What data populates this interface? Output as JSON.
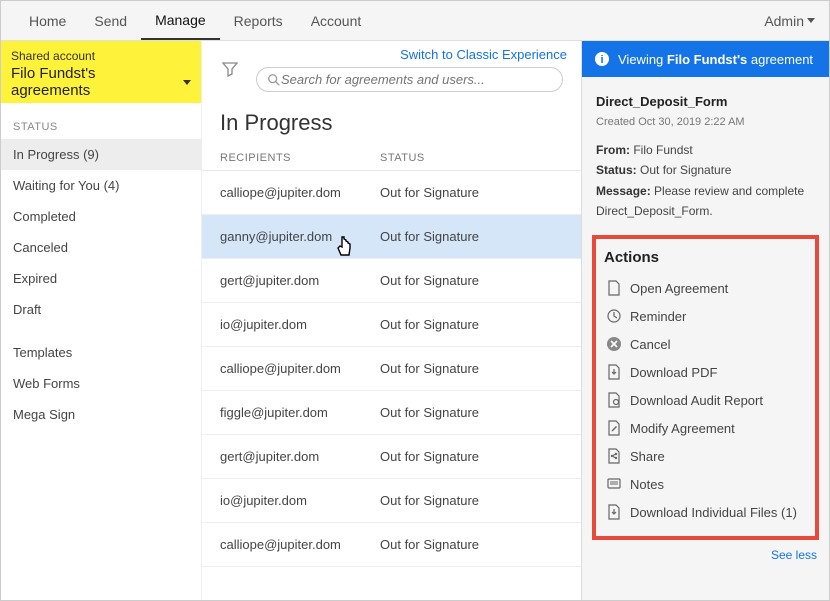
{
  "topnav": {
    "items": [
      "Home",
      "Send",
      "Manage",
      "Reports",
      "Account"
    ],
    "active": "Manage",
    "admin": "Admin"
  },
  "classic_link": "Switch to Classic Experience",
  "shared": {
    "label": "Shared account",
    "who": "Filo Fundst's agreements"
  },
  "search": {
    "placeholder": "Search for agreements and users..."
  },
  "sidebar": {
    "heading": "STATUS",
    "filters": [
      {
        "label": "In Progress (9)",
        "selected": true
      },
      {
        "label": "Waiting for You (4)"
      },
      {
        "label": "Completed"
      },
      {
        "label": "Canceled"
      },
      {
        "label": "Expired"
      },
      {
        "label": "Draft"
      }
    ],
    "other": [
      "Templates",
      "Web Forms",
      "Mega Sign"
    ]
  },
  "main": {
    "title": "In Progress",
    "cols": {
      "recipients": "RECIPIENTS",
      "status": "STATUS"
    },
    "rows": [
      {
        "recipient": "calliope@jupiter.dom",
        "status": "Out for Signature"
      },
      {
        "recipient": "ganny@jupiter.dom",
        "status": "Out for Signature",
        "selected": true
      },
      {
        "recipient": "gert@jupiter.dom",
        "status": "Out for Signature"
      },
      {
        "recipient": "io@jupiter.dom",
        "status": "Out for Signature"
      },
      {
        "recipient": "calliope@jupiter.dom",
        "status": "Out for Signature"
      },
      {
        "recipient": "figgle@jupiter.dom",
        "status": "Out for Signature"
      },
      {
        "recipient": "gert@jupiter.dom",
        "status": "Out for Signature"
      },
      {
        "recipient": "io@jupiter.dom",
        "status": "Out for Signature"
      },
      {
        "recipient": "calliope@jupiter.dom",
        "status": "Out for Signature"
      }
    ]
  },
  "detail": {
    "banner_prefix": "Viewing ",
    "banner_name": "Filo Fundst's",
    "banner_suffix": " agreement",
    "title": "Direct_Deposit_Form",
    "created": "Created Oct 30, 2019 2:22 AM",
    "from_label": "From:",
    "from": "Filo Fundst",
    "status_label": "Status:",
    "status": "Out for Signature",
    "message_label": "Message:",
    "message": "Please review and complete Direct_Deposit_Form."
  },
  "actions": {
    "heading": "Actions",
    "items": [
      "Open Agreement",
      "Reminder",
      "Cancel",
      "Download PDF",
      "Download Audit Report",
      "Modify Agreement",
      "Share",
      "Notes",
      "Download Individual Files (1)"
    ],
    "see_less": "See less"
  }
}
